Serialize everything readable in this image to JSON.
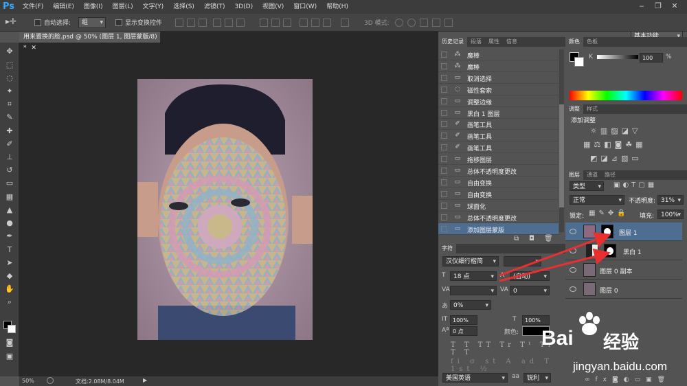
{
  "app": {
    "logo": "Ps",
    "workspace": "基本功能"
  },
  "menu": [
    "文件(F)",
    "编辑(E)",
    "图像(I)",
    "图层(L)",
    "文字(Y)",
    "选择(S)",
    "滤镜(T)",
    "3D(D)",
    "视图(V)",
    "窗口(W)",
    "帮助(H)"
  ],
  "window_buttons": [
    "‒",
    "❐",
    "✕"
  ],
  "options": {
    "auto_select_label": "自动选择:",
    "auto_select_value": "组",
    "show_transform_label": "显示变换控件",
    "mode_3d_label": "3D 模式:"
  },
  "document": {
    "tab_title": "用来置换的脸.psd @ 50% (图层 1, 图层蒙版/8) *",
    "close": "✕",
    "zoom": "50%",
    "doc_info": "文档:2.08M/8.04M"
  },
  "history": {
    "tabs": [
      "历史记录",
      "段落",
      "属性",
      "信息"
    ],
    "items": [
      {
        "icon": "wand-icon",
        "label": "魔棒"
      },
      {
        "icon": "wand-icon",
        "label": "魔棒"
      },
      {
        "icon": "doc-icon",
        "label": "取消选择"
      },
      {
        "icon": "lasso-icon",
        "label": "磁性套索"
      },
      {
        "icon": "doc-icon",
        "label": "调整边缘"
      },
      {
        "icon": "doc-icon",
        "label": "黑白 1 图层"
      },
      {
        "icon": "brush-icon",
        "label": "画笔工具"
      },
      {
        "icon": "brush-icon",
        "label": "画笔工具"
      },
      {
        "icon": "brush-icon",
        "label": "画笔工具"
      },
      {
        "icon": "doc-icon",
        "label": "拖移图层"
      },
      {
        "icon": "doc-icon",
        "label": "总体不透明度更改"
      },
      {
        "icon": "doc-icon",
        "label": "自由变换"
      },
      {
        "icon": "doc-icon",
        "label": "自由变换"
      },
      {
        "icon": "doc-icon",
        "label": "球面化"
      },
      {
        "icon": "doc-icon",
        "label": "总体不透明度更改"
      },
      {
        "icon": "doc-icon",
        "label": "添加图层蒙版"
      }
    ],
    "selected_index": 15
  },
  "character": {
    "tab": "字符",
    "font_family": "汉仪细行楷简",
    "font_size": "18 点",
    "leading": "(自动)",
    "tracking": "0",
    "baseline_pct": "0%",
    "vscale": "100%",
    "hscale": "100%",
    "baseline_shift": "0 点",
    "color_label": "颜色:",
    "language": "美国英语",
    "antialias_label": "aa",
    "antialias": "锐利"
  },
  "color": {
    "tabs": [
      "颜色",
      "色板"
    ],
    "k_label": "K",
    "k_value": "100",
    "pct": "%"
  },
  "adjustments": {
    "tabs": [
      "调整",
      "样式"
    ],
    "add_label": "添加调整"
  },
  "layers": {
    "tabs": [
      "图层",
      "通道",
      "路径"
    ],
    "filter": "类型",
    "blend_mode": "正常",
    "opacity_label": "不透明度:",
    "opacity": "31%",
    "lock_label": "锁定:",
    "fill_label": "填充:",
    "fill": "100%",
    "items": [
      {
        "name": "图层 1",
        "selected": true
      },
      {
        "name": "黑白 1",
        "selected": false
      },
      {
        "name": "图层 0 副本",
        "selected": false
      },
      {
        "name": "图层 0",
        "selected": false
      }
    ]
  },
  "watermark": {
    "brand": "Bai",
    "brand2": "经验",
    "url": "jingyan.baidu.com"
  },
  "colors": {
    "accent": "#4d6d91",
    "arrow": "#e8312f",
    "panel": "#535353"
  }
}
